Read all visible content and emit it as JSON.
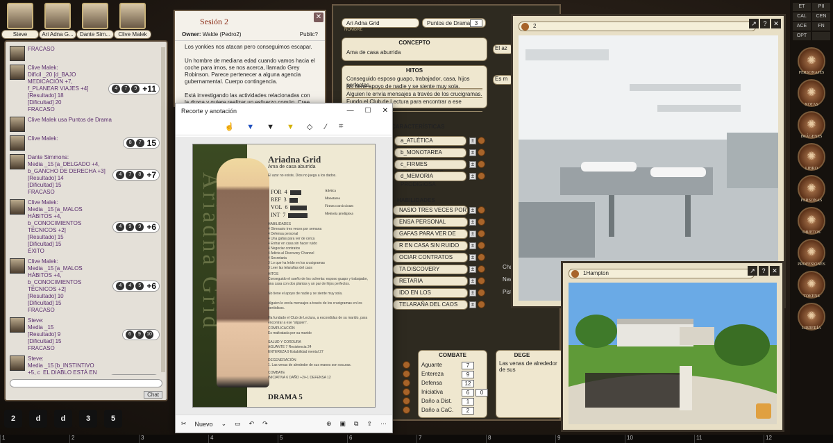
{
  "portraits": [
    {
      "name": "Steve"
    },
    {
      "name": "Ari Adna G..."
    },
    {
      "name": "Dante Sim..."
    },
    {
      "name": "Clive Malek"
    }
  ],
  "chat": {
    "messages": [
      {
        "text": "FRACASO",
        "dice": null
      },
      {
        "text": "Clive Malek:\nDifícil _20 [d_BAJO\nMEDICACIÓN +7,\nf_PLANEAR VIAJES +4]\n[Resultado] 18\n[Dificultad] 20\nFRACASO",
        "dice": [
          "4",
          "7",
          "9"
        ],
        "total": "+11"
      },
      {
        "text": "Clive Malek usa Puntos de Drama",
        "dice": null
      },
      {
        "text": "Clive Malek:",
        "dice": [
          "8",
          "7"
        ],
        "total": "15"
      },
      {
        "text": "Dante Simmons:\nMedia _15 [a_DELGADO +4,\nb_GANCHO DE DERECHA +3]\n[Resultado] 14\n[Dificultad] 15\nFRACASO",
        "dice": [
          "4",
          "7",
          "8"
        ],
        "total": "+7"
      },
      {
        "text": "Clive Malek:\nMedia _15 [a_MALOS\nHÁBITOS +4,\nb_CONOCIMIENTOS\nTÉCNICOS +2]\n[Resultado] 15\n[Dificultad] 15\nÉXITO",
        "dice": [
          "4",
          "9",
          "9"
        ],
        "total": "+6"
      },
      {
        "text": "Clive Malek:\nMedia _15 [a_MALOS\nHÁBITOS +4,\nb_CONOCIMIENTOS\nTÉCNICOS +2]\n[Resultado] 10\n[Dificultad] 15\nFRACASO",
        "dice": [
          "4",
          "4",
          "5"
        ],
        "total": "+6"
      },
      {
        "text": "Steve:\nMedia _15\n[Resultado] 9\n[Dificultad] 15\nFRACASO",
        "dice": [
          "6",
          "9",
          "10"
        ],
        "total": ""
      },
      {
        "text": "Steve:\nMedia _15 [b_INSTINTIVO\n+5, c_EL DIABLO ESTÁ EN\nLOS DETALLES +5]\n[Resultado] 17\n[Dificultad] 15\nÉXITO",
        "dice": [
          "5",
          "7",
          "8"
        ],
        "total": "+10"
      }
    ],
    "send_label": "Chat"
  },
  "dicebar": [
    "2",
    "d",
    "d",
    "3",
    "5"
  ],
  "notes": {
    "title": "Sesión 2",
    "owner_label": "Owner:",
    "owner_value": "Walde (Pedro2)",
    "public_label": "Public?",
    "paragraphs": "Los yonkies nos atacan pero conseguimos escapar.\n\nUn hombre de  mediana edad cuando vamos hacia el coche para irnos, se nos acerca, llamado Grey Robinson. Parece pertenecer a alguna agencia gubernamental. Cuerpo contingencia.\n\nEstá investigando las actividades relacionadas con la droga y quiere realizar un esfuerzo común. Cree que sus"
  },
  "snip": {
    "title": "Recorte y anotación",
    "new_label": "Nuevo",
    "card": {
      "name": "Ariadna Grid",
      "concept": "Ama de casa aburrida",
      "vertical": "Ariadna Grid",
      "quote": "El azar no existe, Dios no juega a los dados.",
      "attrs": [
        {
          "label": "FOR",
          "value": "4",
          "trait": "Atlética"
        },
        {
          "label": "REF",
          "value": "3",
          "trait": "Monotarea"
        },
        {
          "label": "VOL",
          "value": "6",
          "trait": "Firmes convicciones"
        },
        {
          "label": "INT",
          "value": "7",
          "trait": "Memoria prodigiosa"
        }
      ],
      "skills_text": "HABILIDADES\n4  Gimnasio tres veces por semana\n4  Defensa personal\n4  Una gafas para ver de cerca\n4  Entrar en casa sin hacer ruido\n4  Negociar contratos\n4  Adicta al Discovery Channel\n4  Secretaria\n3  Lo que ha leído en los crucigramas\n3  Leer las telarañas del caos",
      "hooks_text": "HITOS\nConseguido el sueño de los ochenta: esposo guapo y trabajador, una casa con dos plantas y un par de hijos perfectos.\n\nNo tiene el apoyo de nadie y se siente muy sola.\n\nAlguien le envía mensajes a través de los crucigramas en los periódicos.\n\nHa fundado el Club de Lectura, a escondidas de su marido, para encontrar a ese \"alguien\".",
      "complication": "COMPLICACIÓN\nEs maltratada por su marido",
      "health": "SALUD Y CORDURA\nAGUANTE 7   Resistencia 24\nENTEREZA 9   Estabilidad mental 27",
      "degeneration": "DEGENERACIÓN\n1. Las venas de alrededor de sus manos son oscuras.",
      "combat": "COMBATE\nINICIATIVA 6   DAÑO +2/+1   DEFENSA 12",
      "drama": "DRAMA 5"
    }
  },
  "sheet": {
    "name": "Ari Adna Grid",
    "name_caption": "NOMBRE",
    "drama_label": "Puntos de Drama",
    "drama_value": "3",
    "concept_title": "CONCEPTO",
    "concept": "Ama de casa aburrida",
    "hitos_title": "HITOS",
    "hitos": [
      "Conseguido esposo guapo, trabajador, casa, hijos perfectos.",
      "No tiene apoyo de nadie y se siente muy sola.",
      "Alguien le envía mensajes a través de los crucigramas.",
      "Fundo el Club de Lectura para encontrar a ese \"alguien\""
    ],
    "car_title": "CARACTERÍSTICAS",
    "car": [
      "a_ATLÉTICA",
      "b_MONOTAREA",
      "c_FIRMES CONVICCIONES",
      "d_MEMORIA PRODIGIOSA"
    ],
    "hab_title": "HABILIDADES",
    "hab": [
      "NASIO TRES VECES POR SEMANA",
      "ENSA PERSONAL",
      "GAFAS PARA VER DE CERCA",
      "R EN CASA SIN RUIDO",
      "OCIAR CONTRATOS",
      "TA DISCOVERY CHANNEL",
      "RETARIA",
      "IDO EN LOS CRUCIGRAMAS",
      "TELARAÑA DEL CAOS"
    ],
    "combat_title": "COMBATE",
    "combat": [
      {
        "label": "Aguante",
        "v1": "7",
        "v2": ""
      },
      {
        "label": "Entereza",
        "v1": "9",
        "v2": ""
      },
      {
        "label": "Defensa",
        "v1": "12",
        "v2": ""
      },
      {
        "label": "Iniciativa",
        "v1": "6",
        "v2": "0"
      },
      {
        "label": "Daño a Dist.",
        "v1": "1",
        "v2": ""
      },
      {
        "label": "Daño a CaC.",
        "v1": "2",
        "v2": ""
      }
    ],
    "deg_title": "DEGE",
    "deg_text": "Las venas de alrededor de sus",
    "partial_side": [
      "El az",
      "Es m",
      "Cha",
      "Nav",
      "Pist"
    ]
  },
  "lab_window": {
    "title": "2"
  },
  "house_window": {
    "title": "1Hampton"
  },
  "sidebar": {
    "top": [
      "ET",
      "PII",
      "CAL",
      "CEN",
      "ACE",
      "FN",
      "OPT",
      ""
    ],
    "buttons": [
      "PERSONAJES",
      "NOTAS",
      "IMÁGENES",
      "LIBRO",
      "PERSONAS",
      "OBJETOS",
      "PROFESIONES",
      "TOKENS",
      "LIBRERÍA"
    ]
  },
  "bottom_strip": [
    "1",
    "2",
    "3",
    "4",
    "5",
    "6",
    "7",
    "8",
    "9",
    "10",
    "11",
    "12"
  ]
}
